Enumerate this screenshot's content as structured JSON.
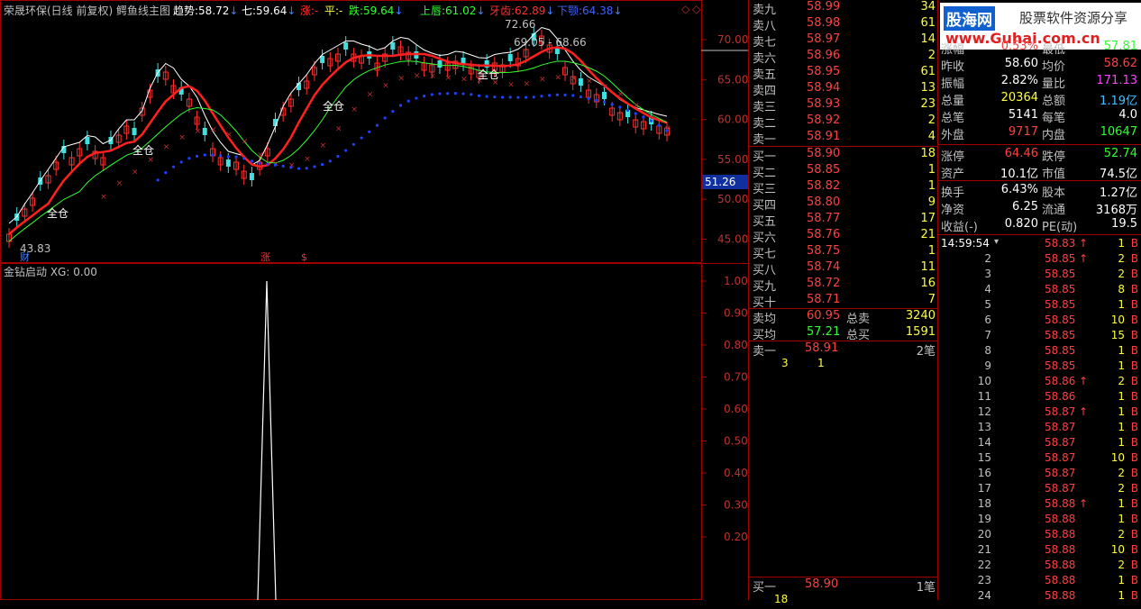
{
  "header": {
    "title": "荣晟环保(日线 前复权)",
    "indicator": "鳄鱼线主图",
    "trend_label": "趋势:",
    "trend_value": "58.72",
    "qi_label": "七:",
    "qi_value": "59.64",
    "zhang_label": "涨:",
    "zhang_value": "-",
    "ping_label": "平:",
    "ping_value": "-",
    "die_label": "跌:",
    "die_value": "59.64",
    "lip_label": "上唇:",
    "lip_value": "61.02",
    "teeth_label": "牙齿:",
    "teeth_value": "62.89",
    "jaw_label": "下颚:",
    "jaw_value": "64.38"
  },
  "main_chart": {
    "annotations": {
      "high": "72.66",
      "range": "69.05 - 68.66",
      "low": "43.83",
      "current": "51.26",
      "fin_tag": "财",
      "zhang_tag": "涨",
      "dollar_tag": "$",
      "quancang": "全仓"
    },
    "y_labels": [
      "70.00",
      "65.00",
      "60.00",
      "55.00",
      "50.00",
      "45.00"
    ]
  },
  "osc_chart": {
    "title": "金钻启动 XG: 0.00",
    "y_labels": [
      "1.00",
      "0.90",
      "0.80",
      "0.70",
      "0.60",
      "0.50",
      "0.40",
      "0.30",
      "0.20"
    ]
  },
  "order_book": {
    "sell": [
      {
        "label": "卖九",
        "price": "58.99",
        "vol": "34"
      },
      {
        "label": "卖八",
        "price": "58.98",
        "vol": "61"
      },
      {
        "label": "卖七",
        "price": "58.97",
        "vol": "14"
      },
      {
        "label": "卖六",
        "price": "58.96",
        "vol": "2"
      },
      {
        "label": "卖五",
        "price": "58.95",
        "vol": "61"
      },
      {
        "label": "卖四",
        "price": "58.94",
        "vol": "13"
      },
      {
        "label": "卖三",
        "price": "58.93",
        "vol": "23"
      },
      {
        "label": "卖二",
        "price": "58.92",
        "vol": "2"
      },
      {
        "label": "卖一",
        "price": "58.91",
        "vol": "4"
      }
    ],
    "buy": [
      {
        "label": "买一",
        "price": "58.90",
        "vol": "18"
      },
      {
        "label": "买二",
        "price": "58.85",
        "vol": "1"
      },
      {
        "label": "买三",
        "price": "58.82",
        "vol": "1"
      },
      {
        "label": "买四",
        "price": "58.80",
        "vol": "9"
      },
      {
        "label": "买五",
        "price": "58.77",
        "vol": "17"
      },
      {
        "label": "买六",
        "price": "58.76",
        "vol": "21"
      },
      {
        "label": "买七",
        "price": "58.75",
        "vol": "1"
      },
      {
        "label": "买八",
        "price": "58.74",
        "vol": "11"
      },
      {
        "label": "买九",
        "price": "58.72",
        "vol": "16"
      },
      {
        "label": "买十",
        "price": "58.71",
        "vol": "7"
      }
    ],
    "avg_sell_label": "卖均",
    "avg_sell": "60.95",
    "total_sell_label": "总卖",
    "total_sell": "3240",
    "avg_buy_label": "买均",
    "avg_buy": "57.21",
    "total_buy_label": "总买",
    "total_buy": "1591",
    "sell1_label": "卖一",
    "sell1_price": "58.91",
    "sell1_count": "2笔",
    "sell1_detail_a": "3",
    "sell1_detail_b": "1",
    "buy1_label": "买一",
    "buy1_price": "58.90",
    "buy1_count": "1笔",
    "buy1_detail": "18"
  },
  "watermark": {
    "brand": "股海网",
    "slogan": "股票软件资源分享",
    "url": "www.Guhai.com.cn"
  },
  "stats": [
    {
      "l1": "涨幅",
      "v1": "0.53%",
      "l2": "最低",
      "v2": "57.81"
    },
    {
      "l1": "昨收",
      "v1": "58.60",
      "l2": "均价",
      "v2": "58.62"
    },
    {
      "l1": "振幅",
      "v1": "2.82%",
      "l2": "量比",
      "v2": "171.13"
    },
    {
      "l1": "总量",
      "v1": "20364",
      "l2": "总额",
      "v2": "1.19亿"
    },
    {
      "l1": "总笔",
      "v1": "5141",
      "l2": "每笔",
      "v2": "4.0"
    },
    {
      "l1": "外盘",
      "v1": "9717",
      "l2": "内盘",
      "v2": "10647"
    },
    {
      "l1": "涨停",
      "v1": "64.46",
      "l2": "跌停",
      "v2": "52.74"
    },
    {
      "l1": "资产",
      "v1": "10.1亿",
      "l2": "市值",
      "v2": "74.5亿"
    },
    {
      "l1": "换手",
      "v1": "6.43%",
      "l2": "股本",
      "v2": "1.27亿"
    },
    {
      "l1": "净资",
      "v1": "6.25",
      "l2": "流通",
      "v2": "3168万"
    },
    {
      "l1": "收益(-)",
      "v1": "0.820",
      "l2": "PE(动)",
      "v2": "19.5"
    }
  ],
  "ticks": {
    "time": "14:59:54",
    "rows": [
      {
        "n": "",
        "p": "58.83",
        "a": "↑",
        "v": "1",
        "s": "B"
      },
      {
        "n": "2",
        "p": "58.85",
        "a": "↑",
        "v": "2",
        "s": "B"
      },
      {
        "n": "3",
        "p": "58.85",
        "a": "",
        "v": "2",
        "s": "B"
      },
      {
        "n": "4",
        "p": "58.85",
        "a": "",
        "v": "8",
        "s": "B"
      },
      {
        "n": "5",
        "p": "58.85",
        "a": "",
        "v": "1",
        "s": "B"
      },
      {
        "n": "6",
        "p": "58.85",
        "a": "",
        "v": "10",
        "s": "B"
      },
      {
        "n": "7",
        "p": "58.85",
        "a": "",
        "v": "15",
        "s": "B"
      },
      {
        "n": "8",
        "p": "58.85",
        "a": "",
        "v": "1",
        "s": "B"
      },
      {
        "n": "9",
        "p": "58.85",
        "a": "",
        "v": "1",
        "s": "B"
      },
      {
        "n": "10",
        "p": "58.86",
        "a": "↑",
        "v": "2",
        "s": "B"
      },
      {
        "n": "11",
        "p": "58.86",
        "a": "",
        "v": "1",
        "s": "B"
      },
      {
        "n": "12",
        "p": "58.87",
        "a": "↑",
        "v": "1",
        "s": "B"
      },
      {
        "n": "13",
        "p": "58.87",
        "a": "",
        "v": "1",
        "s": "B"
      },
      {
        "n": "14",
        "p": "58.87",
        "a": "",
        "v": "1",
        "s": "B"
      },
      {
        "n": "15",
        "p": "58.87",
        "a": "",
        "v": "10",
        "s": "B"
      },
      {
        "n": "16",
        "p": "58.87",
        "a": "",
        "v": "2",
        "s": "B"
      },
      {
        "n": "17",
        "p": "58.87",
        "a": "",
        "v": "2",
        "s": "B"
      },
      {
        "n": "18",
        "p": "58.88",
        "a": "↑",
        "v": "1",
        "s": "B"
      },
      {
        "n": "19",
        "p": "58.88",
        "a": "",
        "v": "1",
        "s": "B"
      },
      {
        "n": "20",
        "p": "58.88",
        "a": "",
        "v": "2",
        "s": "B"
      },
      {
        "n": "21",
        "p": "58.88",
        "a": "",
        "v": "10",
        "s": "B"
      },
      {
        "n": "22",
        "p": "58.88",
        "a": "",
        "v": "2",
        "s": "B"
      },
      {
        "n": "23",
        "p": "58.88",
        "a": "",
        "v": "1",
        "s": "B"
      },
      {
        "n": "24",
        "p": "58.88",
        "a": "",
        "v": "1",
        "s": "B"
      }
    ]
  }
}
